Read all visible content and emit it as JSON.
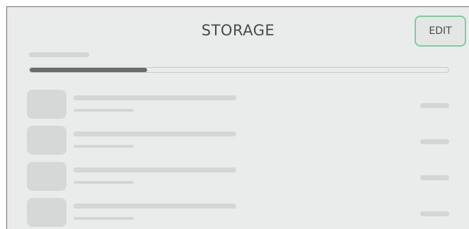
{
  "header": {
    "title": "STORAGE",
    "edit_label": "EDIT"
  },
  "storage": {
    "used_fraction": 0.28
  },
  "colors": {
    "accent": "#7fcca0",
    "background": "#eaeceb",
    "placeholder": "#d4d6d5",
    "progress_fill": "#6b6b6b"
  },
  "items_count_visible": 4
}
